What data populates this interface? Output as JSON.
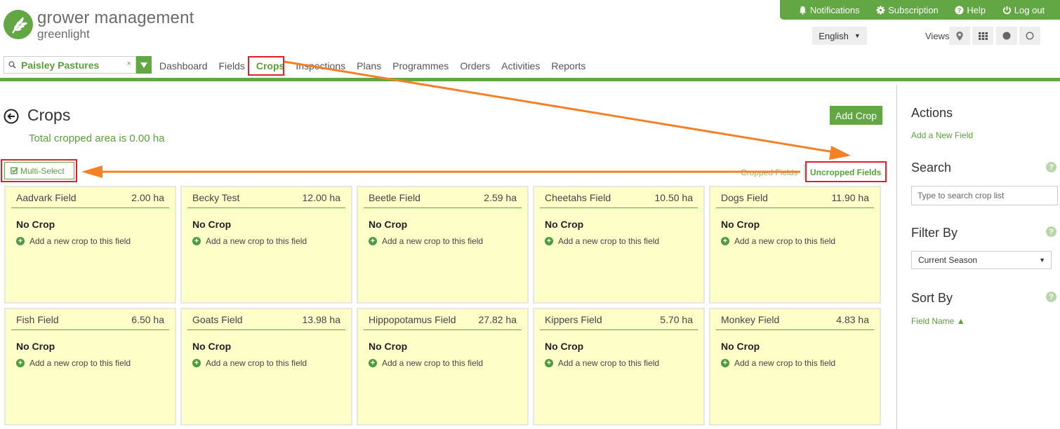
{
  "brand": {
    "title": "grower management",
    "subtitle": "greenlight",
    "logo_icon": "wheat-leaf-icon"
  },
  "topbar": {
    "items": [
      {
        "label": "Notifications",
        "icon": "bell-icon"
      },
      {
        "label": "Subscription",
        "icon": "gear-icon"
      },
      {
        "label": "Help",
        "icon": "question-circle-icon"
      },
      {
        "label": "Log out",
        "icon": "power-icon"
      }
    ]
  },
  "language": {
    "selected": "English"
  },
  "views": {
    "label": "Views",
    "buttons": [
      {
        "name": "map-pin-view",
        "icon": "map-pin-icon"
      },
      {
        "name": "grid-view",
        "icon": "grid-icon"
      },
      {
        "name": "filled-circle-view",
        "icon": "filled-circle-icon"
      },
      {
        "name": "empty-circle-view",
        "icon": "empty-circle-icon"
      }
    ]
  },
  "farm_select": {
    "value": "Paisley Pastures",
    "clear": "×"
  },
  "nav": {
    "items": [
      {
        "label": "Dashboard",
        "active": false
      },
      {
        "label": "Fields",
        "active": false
      },
      {
        "label": "Crops",
        "active": true
      },
      {
        "label": "Inspections",
        "active": false
      },
      {
        "label": "Plans",
        "active": false
      },
      {
        "label": "Programmes",
        "active": false
      },
      {
        "label": "Orders",
        "active": false
      },
      {
        "label": "Activities",
        "active": false
      },
      {
        "label": "Reports",
        "active": false
      }
    ]
  },
  "page": {
    "title": "Crops",
    "total_area": "Total cropped area is 0.00 ha",
    "add_crop": "Add Crop",
    "multi_select": "Multi-Select",
    "tabs": {
      "cropped": "Cropped Fields",
      "uncropped": "Uncropped Fields",
      "active": "uncropped"
    }
  },
  "cards": [
    {
      "name": "Aadvark Field",
      "area": "2.00 ha",
      "crop": "No Crop",
      "add": "Add a new crop to this field"
    },
    {
      "name": "Becky Test",
      "area": "12.00 ha",
      "crop": "No Crop",
      "add": "Add a new crop to this field"
    },
    {
      "name": "Beetle Field",
      "area": "2.59 ha",
      "crop": "No Crop",
      "add": "Add a new crop to this field"
    },
    {
      "name": "Cheetahs Field",
      "area": "10.50 ha",
      "crop": "No Crop",
      "add": "Add a new crop to this field"
    },
    {
      "name": "Dogs Field",
      "area": "11.90 ha",
      "crop": "No Crop",
      "add": "Add a new crop to this field"
    },
    {
      "name": "Fish Field",
      "area": "6.50 ha",
      "crop": "No Crop",
      "add": "Add a new crop to this field"
    },
    {
      "name": "Goats Field",
      "area": "13.98 ha",
      "crop": "No Crop",
      "add": "Add a new crop to this field"
    },
    {
      "name": "Hippopotamus Field",
      "area": "27.82 ha",
      "crop": "No Crop",
      "add": "Add a new crop to this field"
    },
    {
      "name": "Kippers Field",
      "area": "5.70 ha",
      "crop": "No Crop",
      "add": "Add a new crop to this field"
    },
    {
      "name": "Monkey Field",
      "area": "4.83 ha",
      "crop": "No Crop",
      "add": "Add a new crop to this field"
    }
  ],
  "sidebar": {
    "actions_title": "Actions",
    "add_field": "Add a New Field",
    "search_title": "Search",
    "search_placeholder": "Type to search crop list",
    "filter_title": "Filter By",
    "filter_value": "Current Season",
    "sort_title": "Sort By",
    "sort_value": "Field Name ▲",
    "help": "?"
  },
  "colors": {
    "brand_green": "#62a744",
    "card_bg": "#fefec8",
    "annotation_red": "#e3202a",
    "annotation_arrow": "#f58025"
  }
}
